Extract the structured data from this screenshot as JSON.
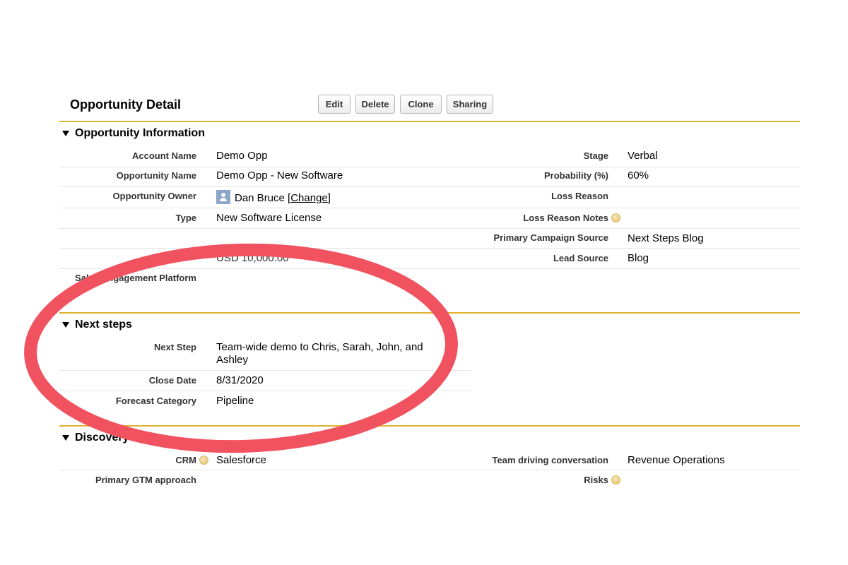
{
  "header": {
    "title": "Opportunity Detail",
    "buttons": {
      "edit": "Edit",
      "delete": "Delete",
      "clone": "Clone",
      "sharing": "Sharing"
    }
  },
  "sections": {
    "opportunity_information": {
      "title": "Opportunity Information",
      "left": [
        {
          "label": "Account Name",
          "value": "Demo Opp"
        },
        {
          "label": "Opportunity Name",
          "value": "Demo Opp - New Software"
        },
        {
          "label": "Opportunity Owner",
          "value": "Dan Bruce",
          "link_prefix": "[",
          "link": "Change",
          "link_suffix": "]"
        },
        {
          "label": "Type",
          "value": "New Software License"
        },
        {
          "label": "",
          "value": ""
        },
        {
          "label": "",
          "value": "USD 10,000.00"
        },
        {
          "label": "Sales Engagement Platform",
          "value": ""
        }
      ],
      "right": [
        {
          "label": "Stage",
          "value": "Verbal"
        },
        {
          "label": "Probability (%)",
          "value": "60%"
        },
        {
          "label": "Loss Reason",
          "value": ""
        },
        {
          "label": "Loss Reason Notes",
          "value": ""
        },
        {
          "label": "Primary Campaign Source",
          "value": "Next Steps Blog"
        },
        {
          "label": "Lead Source",
          "value": "Blog"
        }
      ]
    },
    "next_steps": {
      "title": "Next steps",
      "rows": [
        {
          "label": "Next Step",
          "value_line1": "Team-wide demo to Chris, Sarah, John, and",
          "value_line2": "Ashley"
        },
        {
          "label": "Close Date",
          "value": "8/31/2020"
        },
        {
          "label": "Forecast Category",
          "value": "Pipeline"
        }
      ]
    },
    "discovery": {
      "title": "Discovery",
      "left": [
        {
          "label": "CRM",
          "value": "Salesforce"
        },
        {
          "label": "Primary GTM approach",
          "value": ""
        }
      ],
      "right": [
        {
          "label": "Team driving conversation",
          "value": "Revenue Operations"
        },
        {
          "label": "Risks",
          "value": ""
        }
      ]
    }
  },
  "annotation": {
    "color": "#f0525f"
  },
  "icons": {
    "help": "help-icon",
    "avatar": "user-avatar-icon",
    "section_toggle": "triangle-down-icon"
  }
}
